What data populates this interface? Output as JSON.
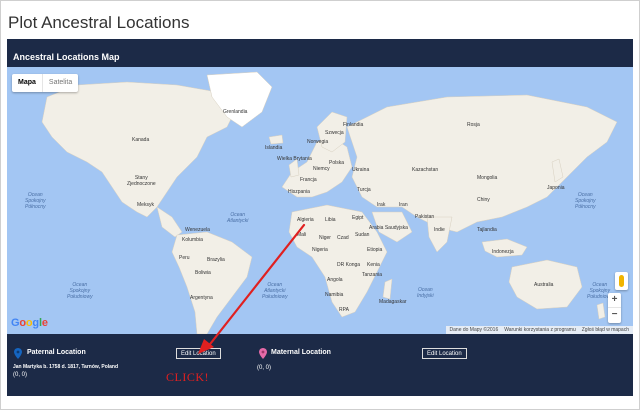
{
  "page": {
    "title": "Plot Ancestral Locations"
  },
  "panel": {
    "title": "Ancestral Locations Map"
  },
  "map": {
    "type_controls": {
      "map_label": "Mapa",
      "satellite_label": "Satelita",
      "selected": "Mapa"
    },
    "zoom": {
      "in": "+",
      "out": "−"
    },
    "logo": [
      "G",
      "o",
      "o",
      "g",
      "l",
      "e"
    ],
    "attribution": [
      "Dane do Mapy ©2016",
      "Warunki korzystania z programu",
      "Zgłoś błąd w mapach"
    ],
    "labels": {
      "greenland": "Grenlandia",
      "iceland": "Islandia",
      "canada": "Kanada",
      "usa": "Stany\nZjednoczone",
      "mexico": "Meksyk",
      "brazil": "Brazylia",
      "peru": "Peru",
      "bolivia": "Boliwia",
      "argentina": "Argentyna",
      "russia": "Rosja",
      "kazakhstan": "Kazachstan",
      "mongolia": "Mongolia",
      "china": "Chiny",
      "india": "Indie",
      "iran": "Iran",
      "pakistan": "Pakistan",
      "turkey": "Turcja",
      "ukraine": "Ukraina",
      "poland": "Polska",
      "germany": "Niemcy",
      "france": "Francja",
      "spain": "Hiszpania",
      "sweden": "Szwecja",
      "finland": "Finlandia",
      "norway": "Norwegia",
      "uk": "Wielka Brytania",
      "algeria": "Algieria",
      "libya": "Libia",
      "egypt": "Egipt",
      "mali": "Mali",
      "niger": "Niger",
      "chad": "Czad",
      "sudan": "Sudan",
      "nigeria": "Nigeria",
      "ethiopia": "Etiopia",
      "congo": "DR Konga",
      "angola": "Angola",
      "namibia": "Namibia",
      "rpa": "RPA",
      "madagascar": "Madagaskar",
      "saudi": "Arabia Saudyjska",
      "iraq": "Irak",
      "australia": "Australia",
      "indonesia": "Indonezja",
      "thailand": "Tajlandia",
      "japan": "Japonia",
      "kenya": "Kenia",
      "tanzania": "Tanzania",
      "venezuela": "Wenezuela",
      "colombia": "Kolumbia"
    },
    "oceans": {
      "atlantic": "Ocean\nAtlantycki",
      "pacific_north_left": "Ocean\nSpokojny\nPółnocny",
      "pacific_north_right": "Ocean\nSpokojny\nPółnocny",
      "pacific_south_left": "Ocean\nSpokojny\nPołudniowy",
      "atlantic_south": "Ocean\nAtlantycki\nPołudniowy",
      "indian": "Ocean\nIndyjski",
      "pacific_south_right": "Ocean\nSpokojny\nPołudniowy"
    }
  },
  "paternal": {
    "title": "Paternal Location",
    "description": "Jan Martyka b. 1758 d. 1817, Tarnów, Poland",
    "coords": "(0, 0)",
    "edit_label": "Edit Location",
    "pin_color": "#1565c0"
  },
  "maternal": {
    "title": "Maternal Location",
    "coords": "(0, 0)",
    "edit_label": "Edit Location",
    "pin_color": "#e56aa8"
  },
  "annotation": {
    "text": "CLICK!",
    "color": "#e02020"
  }
}
